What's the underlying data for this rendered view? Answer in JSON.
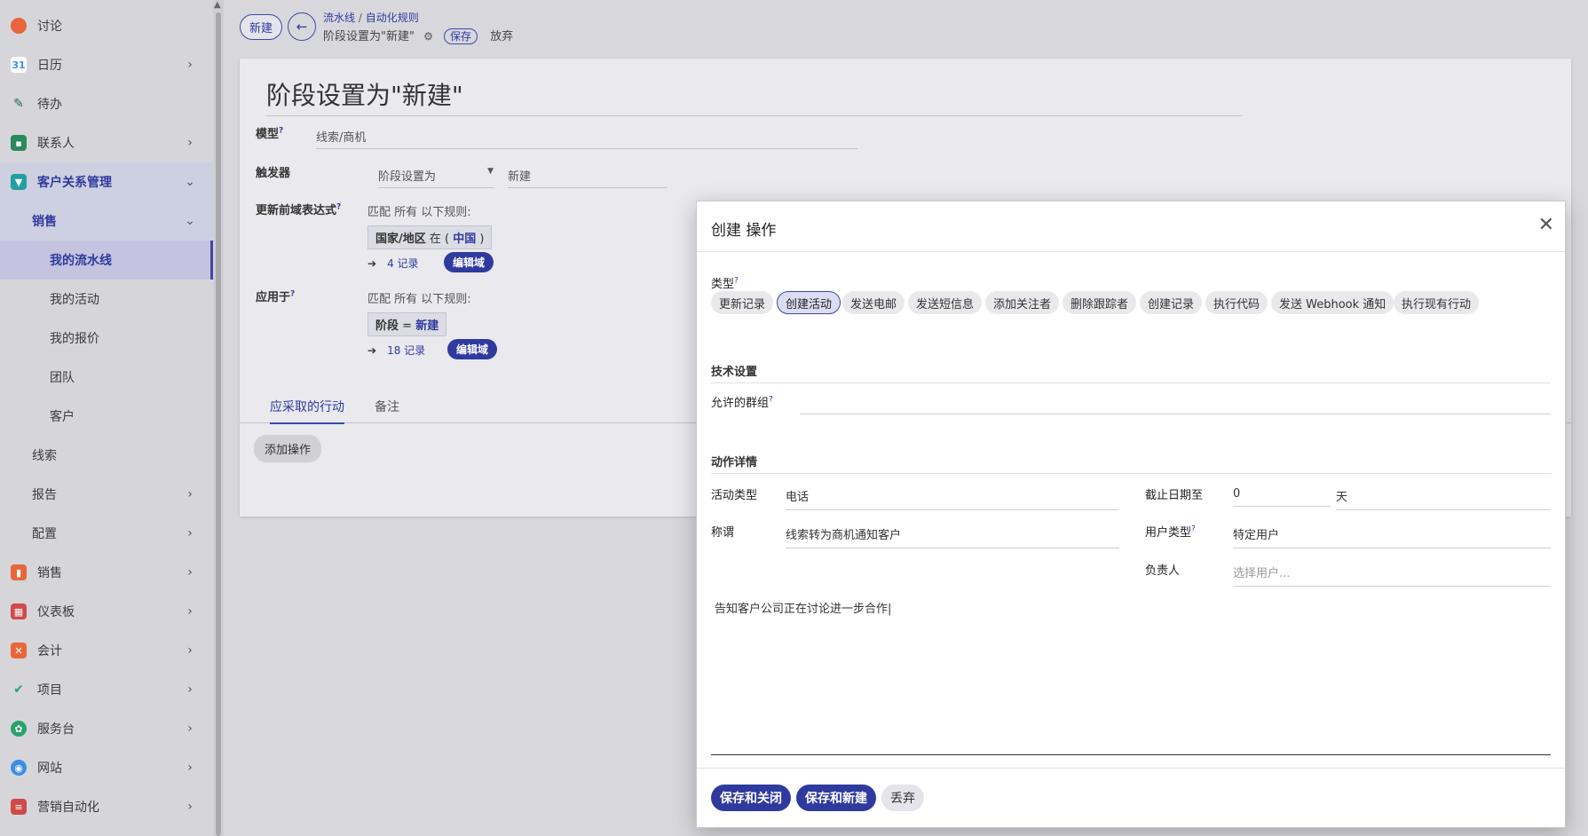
{
  "sidebar": {
    "items": [
      {
        "label": "讨论",
        "icon": "discuss-icon",
        "color": "#e8663a",
        "chevron": false
      },
      {
        "label": "日历",
        "icon": "calendar-icon",
        "color": "#3a8ee8",
        "chevron": true
      },
      {
        "label": "待办",
        "icon": "todo-icon",
        "color": "#2aa36b",
        "chevron": false
      },
      {
        "label": "联系人",
        "icon": "contacts-icon",
        "color": "#2aa36b",
        "chevron": true
      },
      {
        "label": "客户关系管理",
        "icon": "crm-icon",
        "color": "#20a0a0",
        "chevron": true
      },
      {
        "label": "销售",
        "chevron": true
      },
      {
        "label": "我的流水线"
      },
      {
        "label": "我的活动"
      },
      {
        "label": "我的报价"
      },
      {
        "label": "团队"
      },
      {
        "label": "客户"
      },
      {
        "label": "线索"
      },
      {
        "label": "报告",
        "chevron": true
      },
      {
        "label": "配置",
        "chevron": true
      },
      {
        "label": "销售",
        "icon": "sales-icon",
        "color": "#e8663a",
        "chevron": true
      },
      {
        "label": "仪表板",
        "icon": "dashboard-icon",
        "color": "#d04a4a",
        "chevron": true
      },
      {
        "label": "会计",
        "icon": "accounting-icon",
        "color": "#e8663a",
        "chevron": true
      },
      {
        "label": "项目",
        "icon": "project-icon",
        "color": "#2aa36b",
        "chevron": true
      },
      {
        "label": "服务台",
        "icon": "helpdesk-icon",
        "color": "#2aa36b",
        "chevron": true
      },
      {
        "label": "网站",
        "icon": "website-icon",
        "color": "#3a8ee8",
        "chevron": true
      },
      {
        "label": "营销自动化",
        "icon": "marketing-icon",
        "color": "#d04a4a",
        "chevron": true
      }
    ]
  },
  "topbar": {
    "new_label": "新建",
    "breadcrumb_1": "流水线",
    "breadcrumb_sep": "/",
    "breadcrumb_2": "自动化规则",
    "record_title": "阶段设置为\"新建\"",
    "save_label": "保存",
    "discard_label": "放弃"
  },
  "form": {
    "title": "阶段设置为\"新建\"",
    "model_label": "模型",
    "model_value": "线索/商机",
    "trigger_label": "触发器",
    "trigger_value": "阶段设置为",
    "trigger_value2": "新建",
    "domain_label": "更新前域表达式",
    "domain_rule": "匹配 所有 以下规则:",
    "domain_chip_field": "国家/地区",
    "domain_chip_op": "在 (",
    "domain_chip_val": "中国",
    "domain_chip_close": ")",
    "domain_records": "4 记录",
    "edit_domain": "编辑域",
    "apply_label": "应用于",
    "apply_rule": "匹配 所有 以下规则:",
    "apply_chip_field": "阶段",
    "apply_chip_op": "=",
    "apply_chip_val": "新建",
    "apply_records": "18 记录",
    "edit_domain2": "编辑域",
    "tab_actions": "应采取的行动",
    "tab_notes": "备注",
    "add_action": "添加操作"
  },
  "modal": {
    "title": "创建 操作",
    "type_label": "类型",
    "types": [
      "更新记录",
      "创建活动",
      "发送电邮",
      "发送短信息",
      "添加关注者",
      "删除跟踪者",
      "创建记录",
      "执行代码",
      "发送 Webhook 通知",
      "执行现有行动"
    ],
    "selected_type": "创建活动",
    "tech_section": "技术设置",
    "groups_label": "允许的群组",
    "details_section": "动作详情",
    "activity_type_label": "活动类型",
    "activity_type_value": "电话",
    "summary_label": "称谓",
    "summary_value": "线索转为商机通知客户",
    "due_label": "截止日期至",
    "due_value": "0",
    "due_unit": "天",
    "user_type_label": "用户类型",
    "user_type_value": "特定用户",
    "responsible_label": "负责人",
    "responsible_placeholder": "选择用户...",
    "note": "告知客户公司正在讨论进一步合作",
    "save_close": "保存和关闭",
    "save_new": "保存和新建",
    "discard": "丢弃"
  },
  "colors": {
    "accent": "#2f3a9e",
    "overlay": "#d8d8dc"
  }
}
